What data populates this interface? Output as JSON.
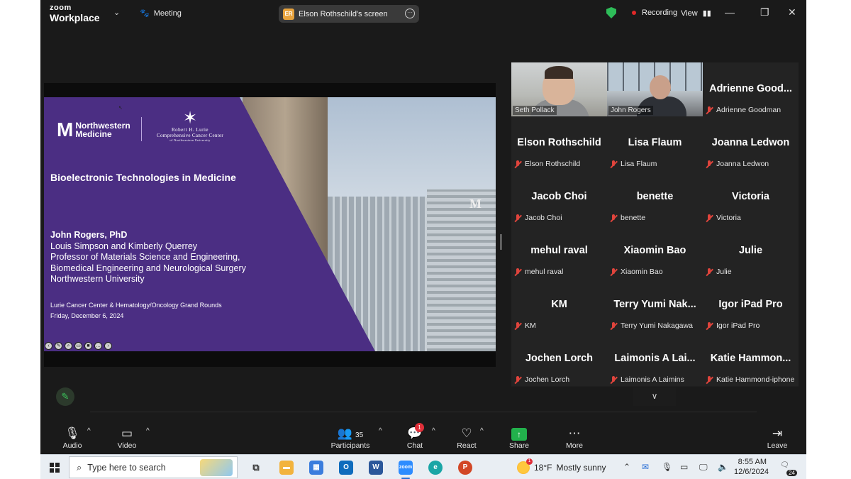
{
  "topbar": {
    "brand_line1": "zoom",
    "brand_line2": "Workplace",
    "meeting_label": "Meeting",
    "share_initials": "ER",
    "share_title": "Elson Rothschild's screen",
    "recording_label": "Recording",
    "view_label": "View"
  },
  "slide": {
    "nm_mark": "M",
    "nm_line1": "Northwestern",
    "nm_line2": "Medicine",
    "lurie_line1": "Robert H. Lurie",
    "lurie_line2": "Comprehensive Cancer Center",
    "lurie_line3": "of Northwestern University",
    "building_logo": "M",
    "title": "Bioelectronic Technologies in Medicine",
    "speaker": "John Rogers, PhD",
    "line2": "Louis Simpson and Kimberly Querrey",
    "line3": "Professor of Materials Science and Engineering,",
    "line4": "Biomedical Engineering and Neurological Surgery",
    "line5": "Northwestern University",
    "event": "Lurie Cancer Center & Hematology/Oncology Grand Rounds",
    "date": "Friday, December 6, 2024"
  },
  "gallery": {
    "video_tiles": [
      {
        "name": "Seth Pollack",
        "active": true
      },
      {
        "name": "John Rogers",
        "active": false
      }
    ],
    "tiles": [
      {
        "big": "Adrienne  Good...",
        "label": "Adrienne Goodman"
      },
      {
        "big": "Elson Rothschild",
        "label": "Elson Rothschild"
      },
      {
        "big": "Lisa Flaum",
        "label": "Lisa Flaum"
      },
      {
        "big": "Joanna Ledwon",
        "label": "Joanna Ledwon"
      },
      {
        "big": "Jacob Choi",
        "label": "Jacob Choi"
      },
      {
        "big": "benette",
        "label": "benette"
      },
      {
        "big": "Victoria",
        "label": "Victoria"
      },
      {
        "big": "mehul raval",
        "label": "mehul raval"
      },
      {
        "big": "Xiaomin Bao",
        "label": "Xiaomin Bao"
      },
      {
        "big": "Julie",
        "label": "Julie"
      },
      {
        "big": "KM",
        "label": "KM"
      },
      {
        "big": "Terry  Yumi  Nak...",
        "label": "Terry Yumi Nakagawa"
      },
      {
        "big": "Igor iPad Pro",
        "label": "Igor iPad Pro"
      },
      {
        "big": "Jochen Lorch",
        "label": "Jochen Lorch"
      },
      {
        "big": "Laimonis  A  Lai...",
        "label": "Laimonis A Laimins"
      },
      {
        "big": "Katie  Hammon...",
        "label": "Katie Hammond-iphone"
      }
    ]
  },
  "toolbar": {
    "audio": "Audio",
    "video": "Video",
    "participants": "Participants",
    "participants_count": "35",
    "chat": "Chat",
    "chat_badge": "1",
    "react": "React",
    "share": "Share",
    "more": "More",
    "leave": "Leave"
  },
  "taskbar": {
    "search_placeholder": "Type here to search",
    "weather_temp": "18°F",
    "weather_desc": "Mostly sunny",
    "weather_badge": "1",
    "time": "8:55 AM",
    "date": "12/6/2024",
    "notifications": "24"
  },
  "colors": {
    "slide_purple": "#4b2e83",
    "active_speaker": "#37c15d",
    "recording_dot": "#e02828",
    "share_green": "#22b14c"
  }
}
